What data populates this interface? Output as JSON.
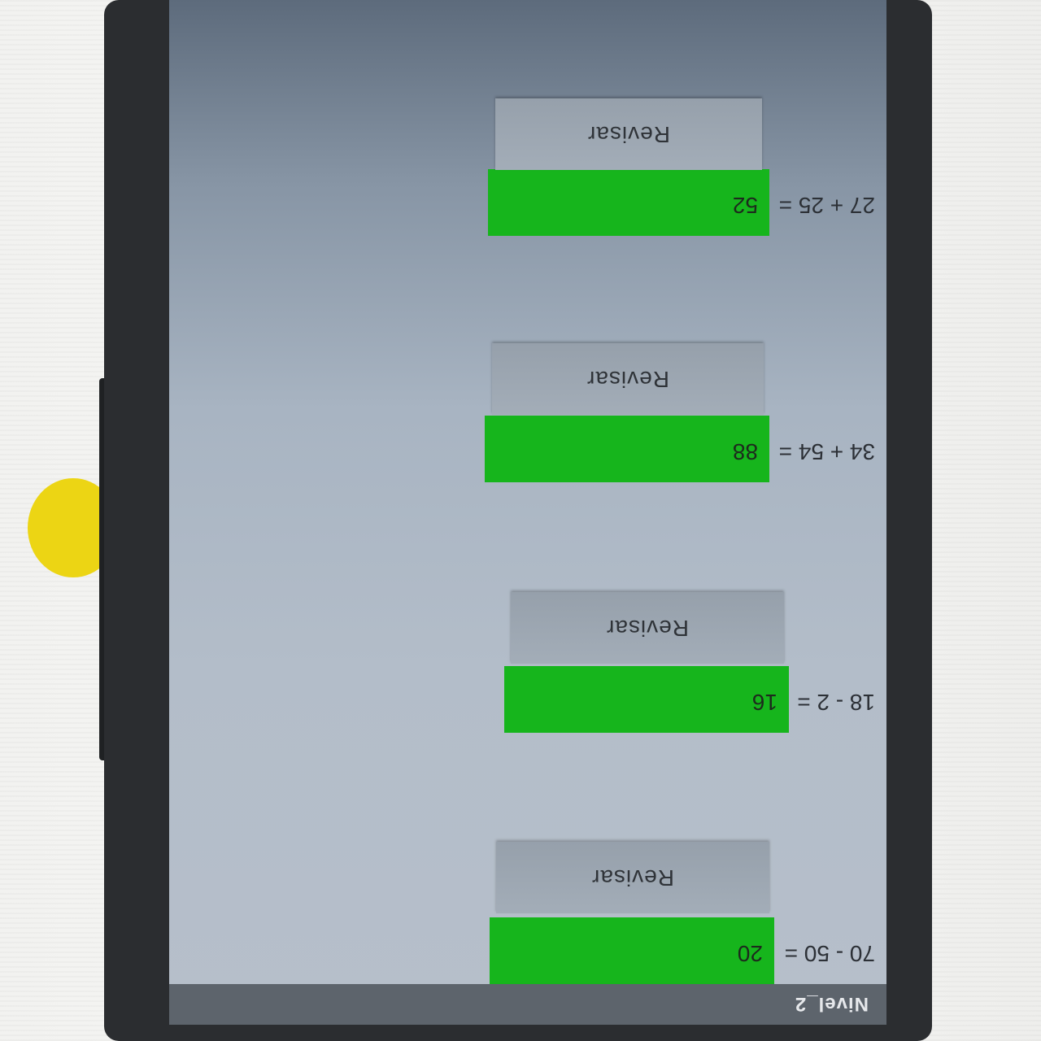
{
  "app": {
    "title": "Nivel_2"
  },
  "problems": [
    {
      "expression": "70 - 50 =",
      "answer": "20",
      "check_label": "Revisar"
    },
    {
      "expression": "18 - 2 =",
      "answer": "16",
      "check_label": "Revisar"
    },
    {
      "expression": "34 + 54 =",
      "answer": "88",
      "check_label": "Revisar"
    },
    {
      "expression": "27 + 25 =",
      "answer": "52",
      "check_label": "Revisar"
    }
  ],
  "colors": {
    "answer_field": "#16b51c",
    "app_bar": "#5d646c",
    "check_button": "#9ba5b0"
  }
}
